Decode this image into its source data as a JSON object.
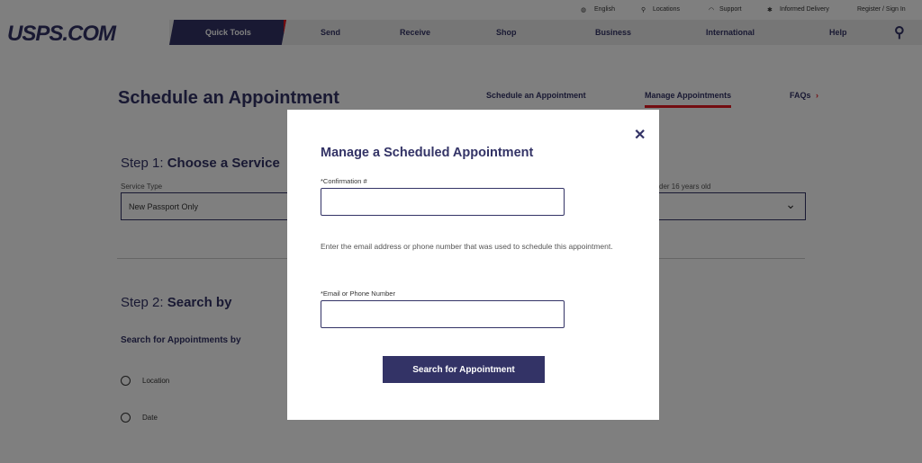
{
  "utility": {
    "english": "English",
    "locations": "Locations",
    "support": "Support",
    "informed": "Informed Delivery",
    "register": "Register / Sign In"
  },
  "logo": "USPS.COM",
  "nav": [
    "Quick Tools",
    "Send",
    "Receive",
    "Shop",
    "Business",
    "International",
    "Help"
  ],
  "page": {
    "title": "Schedule an Appointment",
    "subnav": [
      "Schedule an Appointment",
      "Manage Appointments",
      "FAQs"
    ],
    "step1_prefix": "Step 1:",
    "step1": "Choose a Service",
    "service_label": "Service Type",
    "service_value": "New Passport Only",
    "age_label": "der 16 years old",
    "step2_prefix": "Step 2:",
    "step2": "Search by",
    "search_by": "Search for Appointments by",
    "options": [
      "Location",
      "Date"
    ]
  },
  "modal": {
    "title": "Manage a Scheduled Appointment",
    "close": "✕",
    "confirmation_label": "*Confirmation #",
    "instructions": "Enter the email address or phone number that was used to schedule this appointment.",
    "email_label": "*Email or Phone Number",
    "button": "Search for Appointment"
  }
}
